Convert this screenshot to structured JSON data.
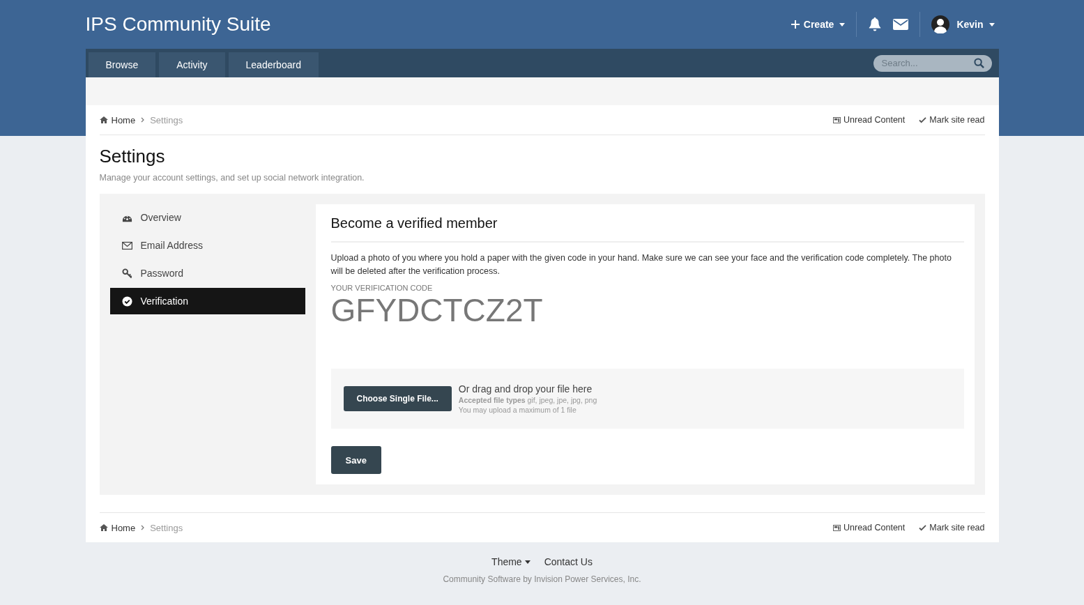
{
  "site_title": "IPS Community Suite",
  "user_bar": {
    "create_label": "Create",
    "user_name": "Kevin"
  },
  "nav": {
    "tabs": [
      {
        "label": "Browse",
        "selected": false
      },
      {
        "label": "Activity",
        "selected": false
      },
      {
        "label": "Leaderboard",
        "selected": false
      }
    ],
    "search": {
      "placeholder": "Search..."
    }
  },
  "breadcrumb_top": {
    "items": [
      "Home",
      "Settings"
    ],
    "actions": [
      {
        "kind": "unread",
        "label": "Unread Content"
      },
      {
        "kind": "mark",
        "label": "Mark site read"
      }
    ]
  },
  "page": {
    "title": "Settings",
    "subtitle": "Manage your account settings, and set up social network integration."
  },
  "sidebar": {
    "items": [
      {
        "kind": "overview",
        "label": "Overview",
        "selected": false
      },
      {
        "kind": "email",
        "label": "Email Address",
        "selected": false
      },
      {
        "kind": "password",
        "label": "Password",
        "selected": false
      },
      {
        "kind": "verification",
        "label": "Verification",
        "selected": true
      }
    ]
  },
  "card": {
    "title": "Become a verified member",
    "description": "Upload a photo of you where you hold a paper with the given code in your hand. Make sure we can see your face and the verification code completely. The photo will be deleted after the verification process.",
    "code_label": "YOUR VERIFICATION CODE",
    "code": "GFYDCTCZ2T",
    "upload": {
      "button": "Choose Single File...",
      "hint": "Or drag and drop your file here",
      "types": "**Accepted file types** gif, jpeg, jpe, jpg, png",
      "limit": "You may upload a maximum of 1 file"
    },
    "save_button": "Save"
  },
  "breadcrumb_bottom": {
    "items": [
      "Home",
      "Settings"
    ],
    "actions": [
      {
        "kind": "unread",
        "label": "Unread Content"
      },
      {
        "kind": "mark",
        "label": "Mark site read"
      }
    ]
  },
  "footer": {
    "links": [
      {
        "label": "Theme",
        "dropdown": true
      },
      {
        "label": "Contact Us",
        "dropdown": false
      }
    ],
    "copyright": "Community Software by Invision Power Services, Inc."
  }
}
